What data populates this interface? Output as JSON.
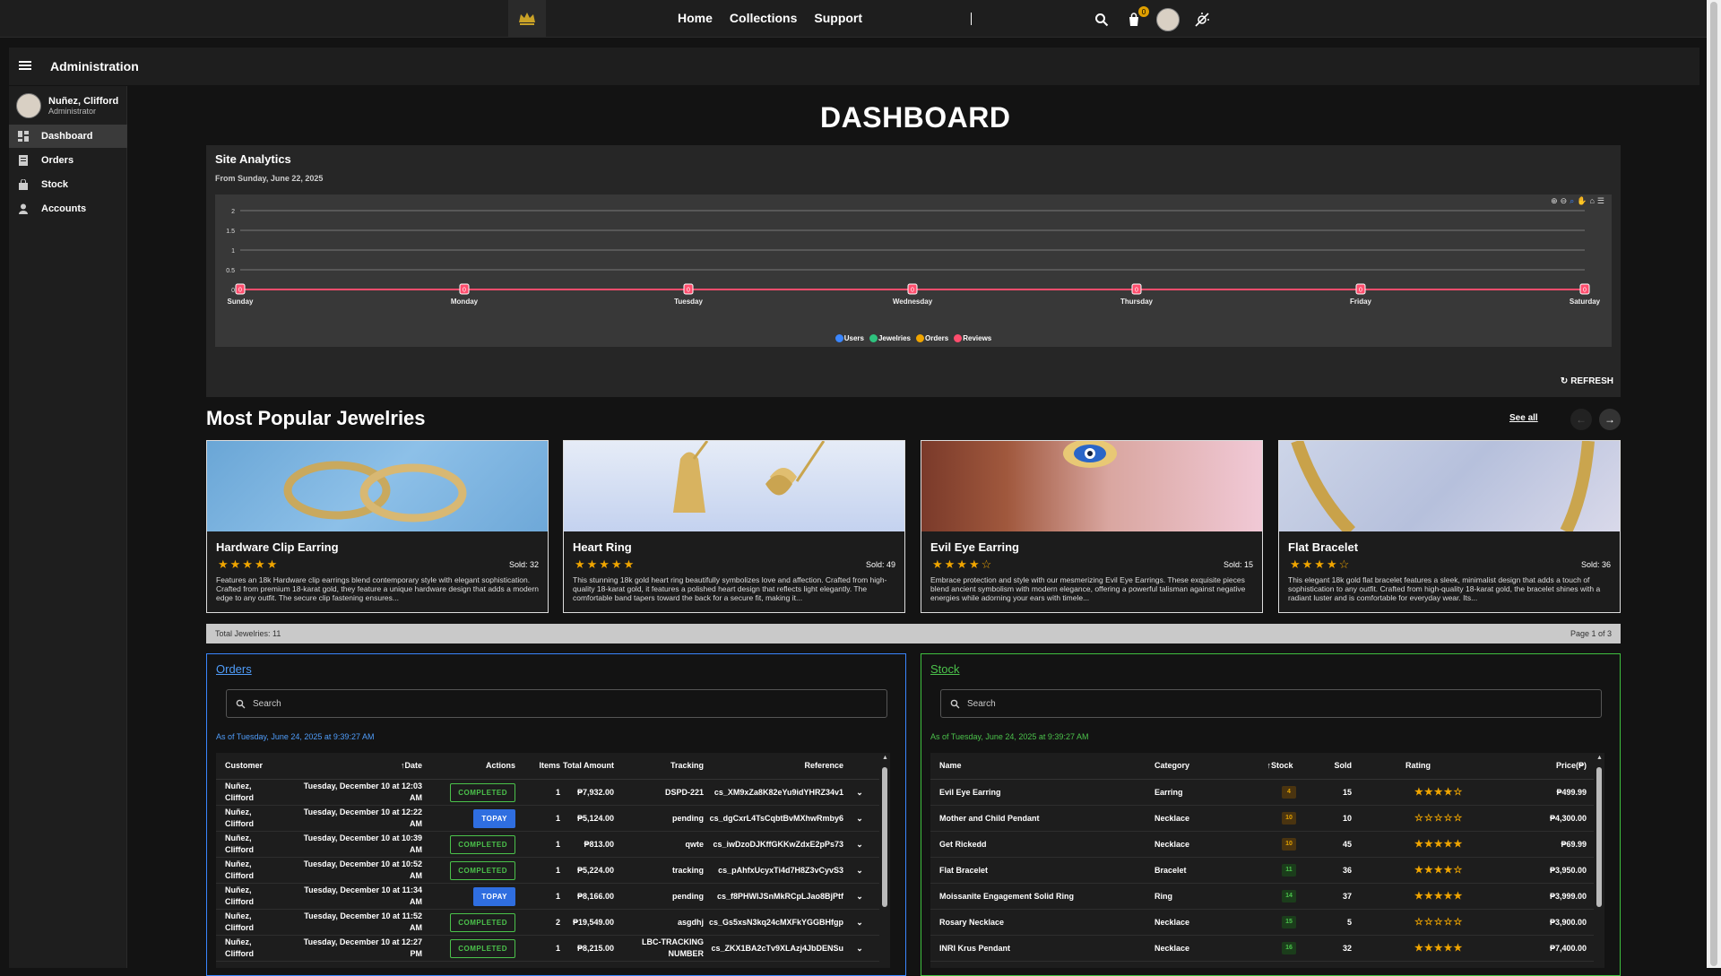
{
  "nav": {
    "links": [
      "Home",
      "Collections",
      "Support"
    ],
    "cart_count": "0"
  },
  "admin": {
    "title": "Administration",
    "user_name": "Nuñez, Clifford",
    "user_role": "Administrator"
  },
  "sidebar": {
    "items": [
      {
        "label": "Dashboard",
        "icon": "dashboard-icon",
        "active": true
      },
      {
        "label": "Orders",
        "icon": "orders-icon"
      },
      {
        "label": "Stock",
        "icon": "stock-icon"
      },
      {
        "label": "Accounts",
        "icon": "accounts-icon"
      }
    ]
  },
  "page_title": "DASHBOARD",
  "analytics": {
    "title": "Site Analytics",
    "subtitle": "From Sunday, June 22, 2025",
    "refresh_label": "REFRESH"
  },
  "chart_data": {
    "type": "line",
    "categories": [
      "Sunday",
      "Monday",
      "Tuesday",
      "Wednesday",
      "Thursday",
      "Friday",
      "Saturday"
    ],
    "series": [
      {
        "name": "Users",
        "color": "#3a86ff",
        "values": [
          0,
          0,
          0,
          0,
          0,
          0,
          0
        ]
      },
      {
        "name": "Jewelries",
        "color": "#2ec27e",
        "values": [
          0,
          0,
          0,
          0,
          0,
          0,
          0
        ]
      },
      {
        "name": "Orders",
        "color": "#f0a500",
        "values": [
          0,
          0,
          0,
          0,
          0,
          0,
          0
        ]
      },
      {
        "name": "Reviews",
        "color": "#ff4d6d",
        "values": [
          0,
          0,
          0,
          0,
          0,
          0,
          0
        ]
      }
    ],
    "data_labels": [
      "0",
      "0",
      "0",
      "0",
      "0",
      "0",
      "0"
    ],
    "yticks": [
      "2",
      "1.5",
      "1",
      "0.5",
      "0"
    ],
    "ylim": [
      0,
      2
    ],
    "grid": true,
    "legend_position": "bottom"
  },
  "popular": {
    "title": "Most Popular Jewelries",
    "see_all": "See all",
    "items": [
      {
        "name": "Hardware Clip Earring",
        "rating": 5,
        "sold": "Sold: 32",
        "desc": "Features an 18k Hardware clip earrings blend contemporary style with elegant sophistication. Crafted from premium 18-karat gold, they feature a unique hardware design that adds a modern edge to any outfit. The secure clip fastening ensures..."
      },
      {
        "name": "Heart Ring",
        "rating": 5,
        "sold": "Sold: 49",
        "desc": "This stunning 18k gold heart ring beautifully symbolizes love and affection. Crafted from high-quality 18-karat gold, it features a polished heart design that reflects light elegantly. The comfortable band tapers toward the back for a secure fit, making it..."
      },
      {
        "name": "Evil Eye Earring",
        "rating": 4,
        "sold": "Sold: 15",
        "desc": "Embrace protection and style with our mesmerizing Evil Eye Earrings. These exquisite pieces blend ancient symbolism with modern elegance, offering a powerful talisman against negative energies while adorning your ears with timele..."
      },
      {
        "name": "Flat Bracelet",
        "rating": 4,
        "sold": "Sold: 36",
        "desc": "This elegant 18k gold flat bracelet features a sleek, minimalist design that adds a touch of sophistication to any outfit. Crafted from high-quality 18-karat gold, the bracelet shines with a radiant luster and is comfortable for everyday wear. Its..."
      }
    ],
    "total": "Total Jewelries: 11",
    "page": "Page 1 of 3"
  },
  "orders": {
    "title": "Orders",
    "search_placeholder": "Search",
    "as_of": "As of Tuesday, June 24, 2025 at 9:39:27 AM",
    "columns": [
      "Customer",
      "Date",
      "Actions",
      "Items",
      "Total Amount",
      "Tracking",
      "Reference"
    ],
    "rows": [
      {
        "customer": "Nuñez, Clifford",
        "date": "Tuesday, December 10 at 12:03 AM",
        "action": "COMPLETED",
        "items": "1",
        "total": "₱7,932.00",
        "tracking": "DSPD-221",
        "ref": "cs_XM9xZa8K82eYu9idYHRZ34v1"
      },
      {
        "customer": "Nuñez, Clifford",
        "date": "Tuesday, December 10 at 12:22 AM",
        "action": "TOPAY",
        "items": "1",
        "total": "₱5,124.00",
        "tracking": "pending",
        "ref": "cs_dgCxrL4TsCqbtBvMXhwRmby6"
      },
      {
        "customer": "Nuñez, Clifford",
        "date": "Tuesday, December 10 at 10:39 AM",
        "action": "COMPLETED",
        "items": "1",
        "total": "₱813.00",
        "tracking": "qwte",
        "ref": "cs_iwDzoDJKffGKKwZdxE2pPs73"
      },
      {
        "customer": "Nuñez, Clifford",
        "date": "Tuesday, December 10 at 10:52 AM",
        "action": "COMPLETED",
        "items": "1",
        "total": "₱5,224.00",
        "tracking": "tracking",
        "ref": "cs_pAhfxUcyxTi4d7H8Z3vCyvS3"
      },
      {
        "customer": "Nuñez, Clifford",
        "date": "Tuesday, December 10 at 11:34 AM",
        "action": "TOPAY",
        "items": "1",
        "total": "₱8,166.00",
        "tracking": "pending",
        "ref": "cs_f8PHWlJSnMkRCpLJao8BjPtf"
      },
      {
        "customer": "Nuñez, Clifford",
        "date": "Tuesday, December 10 at 11:52 AM",
        "action": "COMPLETED",
        "items": "2",
        "total": "₱19,549.00",
        "tracking": "asgdhj",
        "ref": "cs_Gs5xsN3kq24cMXFkYGGBHfgp"
      },
      {
        "customer": "Nuñez, Clifford",
        "date": "Tuesday, December 10 at 12:27 PM",
        "action": "COMPLETED",
        "items": "1",
        "total": "₱8,215.00",
        "tracking": "LBC-TRACKING NUMBER",
        "ref": "cs_ZKX1BA2cTv9XLAzj4JbDENSu"
      }
    ]
  },
  "stock": {
    "title": "Stock",
    "search_placeholder": "Search",
    "as_of": "As of Tuesday, June 24, 2025 at 9:39:27 AM",
    "columns": [
      "Name",
      "Category",
      "Stock",
      "Sold",
      "Rating",
      "Price(₱)"
    ],
    "rows": [
      {
        "name": "Evil Eye Earring",
        "category": "Earring",
        "stock": "4",
        "sold": "15",
        "rating": 4,
        "price": "₱499.99"
      },
      {
        "name": "Mother and Child Pendant",
        "category": "Necklace",
        "stock": "10",
        "sold": "10",
        "rating": 0,
        "price": "₱4,300.00"
      },
      {
        "name": "Get Rickedd",
        "category": "Necklace",
        "stock": "10",
        "sold": "45",
        "rating": 5,
        "price": "₱69.99"
      },
      {
        "name": "Flat Bracelet",
        "category": "Bracelet",
        "stock": "11",
        "sold": "36",
        "rating": 4,
        "price": "₱3,950.00"
      },
      {
        "name": "Moissanite Engagement Solid Ring",
        "category": "Ring",
        "stock": "14",
        "sold": "37",
        "rating": 5,
        "price": "₱3,999.00"
      },
      {
        "name": "Rosary Necklace",
        "category": "Necklace",
        "stock": "15",
        "sold": "5",
        "rating": 0,
        "price": "₱3,900.00"
      },
      {
        "name": "INRI Krus Pendant",
        "category": "Necklace",
        "stock": "16",
        "sold": "32",
        "rating": 5,
        "price": "₱7,400.00"
      }
    ]
  }
}
